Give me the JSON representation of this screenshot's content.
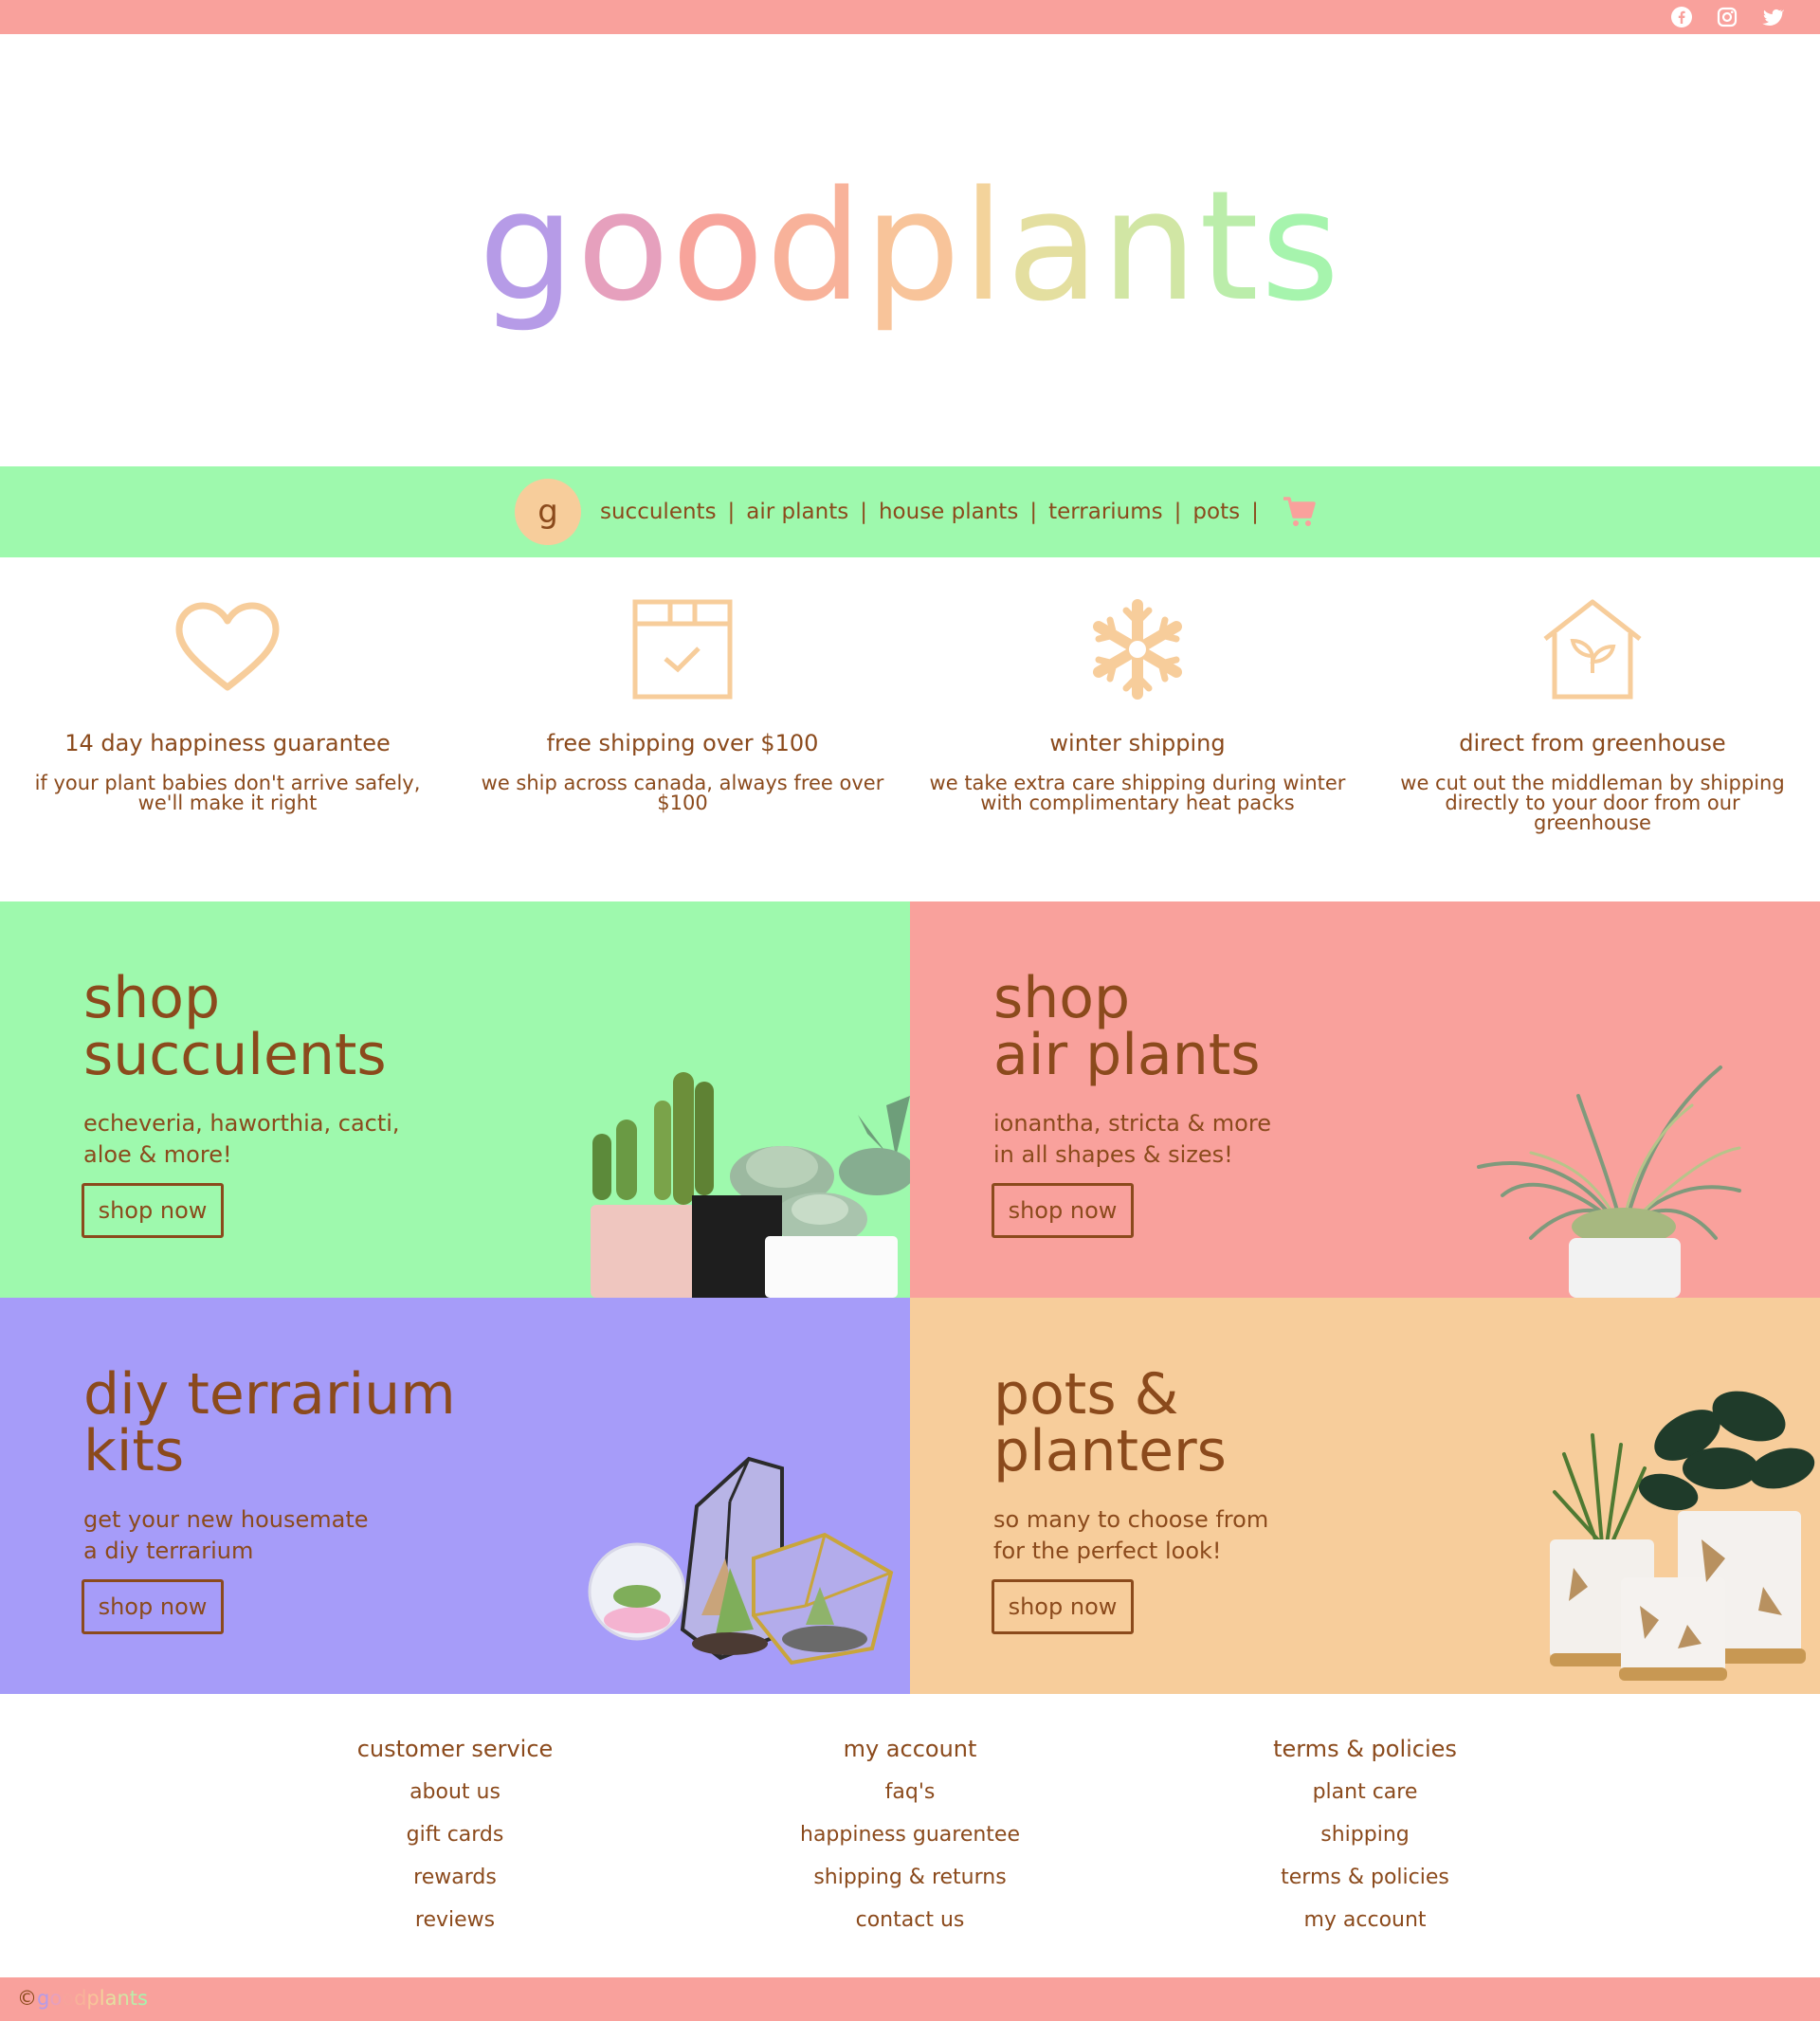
{
  "colors": {
    "pink": "#f9a19c",
    "green": "#9ef9ad",
    "purple": "#a69cf9",
    "peach": "#f7cd9b",
    "brown": "#8b4a1c",
    "logo_gradient": [
      "#b69be7",
      "#e6a0bd",
      "#f7a49b",
      "#f8be9a",
      "#f3d39b",
      "#e4dfa0",
      "#c7e9a7",
      "#a6f4ad"
    ]
  },
  "social": {
    "icons": [
      "facebook-icon",
      "instagram-icon",
      "twitter-icon"
    ]
  },
  "logo": {
    "letters": [
      "g",
      "o",
      "o",
      "d",
      "p",
      "l",
      "a",
      "n",
      "t",
      "s"
    ]
  },
  "nav": {
    "badge": "g",
    "items": [
      "succulents",
      "air plants",
      "house plants",
      "terrariums",
      "pots"
    ],
    "separator": "|",
    "cart_icon": "cart-icon"
  },
  "features": [
    {
      "icon": "heart-icon",
      "title": "14 day happiness guarantee",
      "desc": "if your plant babies don't arrive safely, we'll make it right"
    },
    {
      "icon": "box-check-icon",
      "title": "free shipping over $100",
      "desc": "we ship across canada, always free over $100"
    },
    {
      "icon": "snowflake-icon",
      "title": "winter shipping",
      "desc": "we take extra care shipping during winter with complimentary heat packs"
    },
    {
      "icon": "greenhouse-icon",
      "title": "direct from greenhouse",
      "desc": "we cut out the middleman by shipping directly to your door from our greenhouse"
    }
  ],
  "promos": [
    {
      "title": "shop\nsucculents",
      "desc": "echeveria, haworthia, cacti,\naloe & more!",
      "button": "shop now"
    },
    {
      "title": "shop\nair plants",
      "desc": "ionantha, stricta & more\nin all shapes & sizes!",
      "button": "shop now"
    },
    {
      "title": "diy terrarium\nkits",
      "desc": "get your new housemate\na diy terrarium",
      "button": "shop now"
    },
    {
      "title": "pots &\nplanters",
      "desc": "so many to choose from\nfor the perfect look!",
      "button": "shop now"
    }
  ],
  "footer": {
    "columns": [
      {
        "heading": "customer service",
        "links": [
          "about us",
          "gift cards",
          "rewards",
          "reviews"
        ]
      },
      {
        "heading": "my account",
        "links": [
          "faq's",
          "happiness guarentee",
          "shipping & returns",
          "contact us"
        ]
      },
      {
        "heading": "terms & policies",
        "links": [
          "plant care",
          "shipping",
          "terms & policies",
          "my account"
        ]
      }
    ],
    "copyright_symbol": "©",
    "copyright_brand": [
      "g",
      "o",
      "o",
      "d",
      "p",
      "l",
      "a",
      "n",
      "t",
      "s"
    ]
  }
}
